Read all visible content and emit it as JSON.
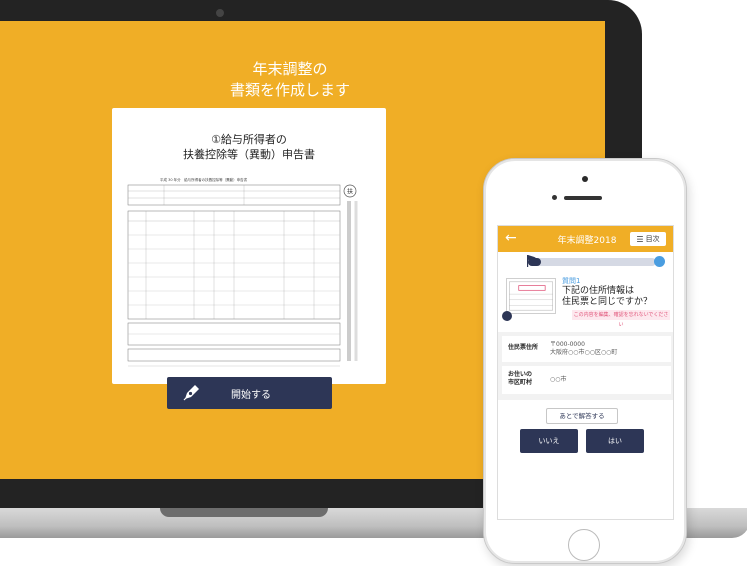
{
  "laptop": {
    "screen_title": "年末調整の\n書類を作成します",
    "document_heading": "①給与所得者の\n扶養控除等（異動）申告書",
    "document_form_title": "平成 30 年分　給与所得者の扶養控除等（異動）申告書",
    "stamp_text": "扶",
    "start_button_label": "開始する",
    "pen_icon": "pen-icon"
  },
  "phone": {
    "app_bar": {
      "back_icon": "←",
      "title": "年末調整2018",
      "menu_label": "目次"
    },
    "progress": {
      "value": 0.1
    },
    "question": {
      "label": "質問1",
      "text": "下記の住所情報は\n住民票と同じですか？",
      "note": "この内容を編集、確認を忘れないでください"
    },
    "address_rows": [
      {
        "key": "住民票住所",
        "value": "〒000-0000\n大阪府○○市○○区○○町"
      },
      {
        "key": "お住いの\n市区町村",
        "value": "○○市"
      }
    ],
    "later_button_label": "あとで解答する",
    "no_button_label": "いいえ",
    "yes_button_label": "はい"
  },
  "colors": {
    "screen_background": "#F0AE26",
    "button_navy": "#2D3656",
    "accent_blue": "#4a9de0"
  }
}
